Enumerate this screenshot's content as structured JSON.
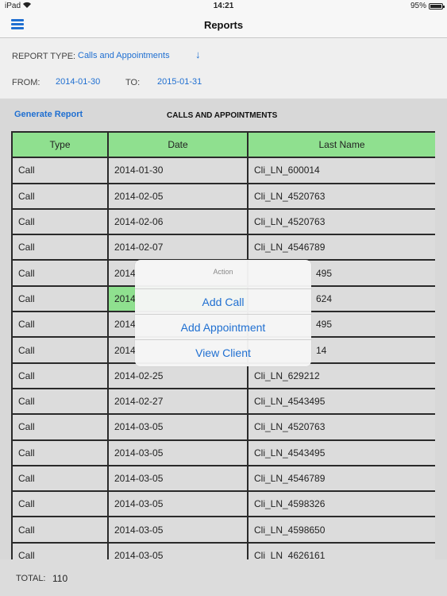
{
  "status_bar": {
    "carrier": "iPad",
    "time": "14:21",
    "battery": "95%",
    "battery_level": 0.95
  },
  "header": {
    "title": "Reports"
  },
  "filters": {
    "report_type_label": "REPORT TYPE:",
    "report_type_value": "Calls and Appointments",
    "from_label": "FROM:",
    "from_value": "2014-01-30",
    "to_label": "TO:",
    "to_value": "2015-01-31"
  },
  "actions": {
    "generate_label": "Generate Report"
  },
  "report": {
    "title": "CALLS AND APPOINTMENTS"
  },
  "table": {
    "columns": [
      "Type",
      "Date",
      "Last Name"
    ],
    "rows": [
      [
        "Call",
        "2014-01-30",
        "Cli_LN_600014"
      ],
      [
        "Call",
        "2014-02-05",
        "Cli_LN_4520763"
      ],
      [
        "Call",
        "2014-02-06",
        "Cli_LN_4520763"
      ],
      [
        "Call",
        "2014-02-07",
        "Cli_LN_4546789"
      ],
      [
        "Call",
        "2014",
        "495"
      ],
      [
        "Call",
        "2014",
        "624"
      ],
      [
        "Call",
        "2014",
        "495"
      ],
      [
        "Call",
        "2014",
        "14"
      ],
      [
        "Call",
        "2014-02-25",
        "Cli_LN_629212"
      ],
      [
        "Call",
        "2014-02-27",
        "Cli_LN_4543495"
      ],
      [
        "Call",
        "2014-03-05",
        "Cli_LN_4520763"
      ],
      [
        "Call",
        "2014-03-05",
        "Cli_LN_4543495"
      ],
      [
        "Call",
        "2014-03-05",
        "Cli_LN_4546789"
      ],
      [
        "Call",
        "2014-03-05",
        "Cli_LN_4598326"
      ],
      [
        "Call",
        "2014-03-05",
        "Cli_LN_4598650"
      ],
      [
        "Call",
        "2014-03-05",
        "Cli_LN_4626161"
      ]
    ]
  },
  "footer": {
    "total_label": "TOTAL:",
    "total_value": "110"
  },
  "popover": {
    "title": "Action",
    "items": [
      "Add Call",
      "Add Appointment",
      "View Client"
    ]
  },
  "colors": {
    "accent": "#1f6fd1",
    "header_green": "#8fe08f",
    "cell_gray": "#dcdcdc"
  }
}
